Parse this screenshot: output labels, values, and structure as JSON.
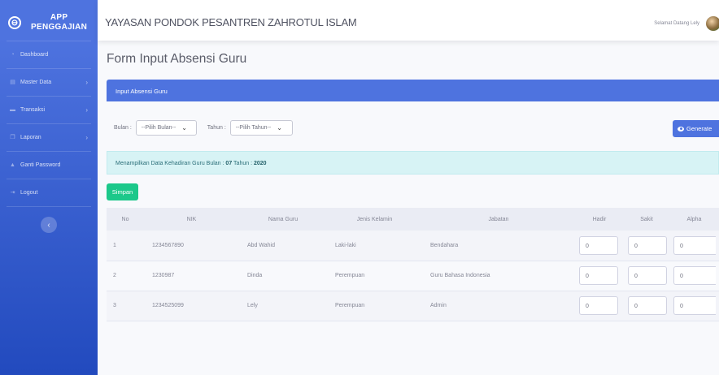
{
  "brand": {
    "logo_glyph": "⊖",
    "line1": "APP",
    "line2": "PENGGAJIAN"
  },
  "sidebar": {
    "items": [
      {
        "label": "Dashboard",
        "icon": "dashboard-icon",
        "has_arrow": false
      },
      {
        "label": "Master Data",
        "icon": "database-icon",
        "has_arrow": true
      },
      {
        "label": "Transaksi",
        "icon": "money-icon",
        "has_arrow": true
      },
      {
        "label": "Laporan",
        "icon": "copy-icon",
        "has_arrow": true
      },
      {
        "label": "Ganti Password",
        "icon": "lock-icon",
        "has_arrow": false
      },
      {
        "label": "Logout",
        "icon": "logout-icon",
        "has_arrow": false
      }
    ],
    "arrow_glyph": "›",
    "collapse_glyph": "‹"
  },
  "topbar": {
    "title": "YAYASAN PONDOK PESANTREN ZAHROTUL ISLAM",
    "user_greeting": "Selamat Datang Lely"
  },
  "page": {
    "title": "Form Input Absensi Guru"
  },
  "card": {
    "header": "Input Absensi Guru"
  },
  "filters": {
    "bulan_label": "Bulan :",
    "bulan_value": "--Pilih Bulan--",
    "tahun_label": "Tahun :",
    "tahun_value": "--Pilih Tahun--",
    "generate_label": "Generate"
  },
  "alert": {
    "prefix": "Menampilkan Data Kehadiran Guru Bulan :",
    "bulan": "07",
    "tahun_label": "Tahun :",
    "tahun": "2020"
  },
  "simpan_label": "Simpan",
  "table": {
    "headers": [
      "No",
      "NIK",
      "Nama Guru",
      "Jenis Kelamin",
      "Jabatan",
      "Hadir",
      "Sakit",
      "Alpha"
    ],
    "rows": [
      {
        "no": "1",
        "nik": "1234567890",
        "nama": "Abd Wahid",
        "jk": "Laki-laki",
        "jabatan": "Bendahara",
        "hadir": "0",
        "sakit": "0",
        "alpha": "0"
      },
      {
        "no": "2",
        "nik": "1230987",
        "nama": "Dinda",
        "jk": "Perempuan",
        "jabatan": "Guru Bahasa Indonesia",
        "hadir": "0",
        "sakit": "0",
        "alpha": "0"
      },
      {
        "no": "3",
        "nik": "1234525099",
        "nama": "Lely",
        "jk": "Perempuan",
        "jabatan": "Admin",
        "hadir": "0",
        "sakit": "0",
        "alpha": "0"
      }
    ]
  },
  "colors": {
    "primary": "#4e73df",
    "success": "#1cc88a",
    "info_bg": "#d7f3f5"
  }
}
